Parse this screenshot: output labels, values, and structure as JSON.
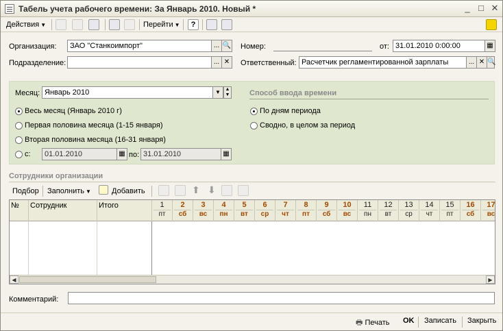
{
  "window": {
    "title": "Табель учета рабочего времени: За Январь 2010. Новый *",
    "minimize": "_",
    "maximize": "□",
    "close": "✕"
  },
  "toolbar": {
    "actions_label": "Действия",
    "goto_label": "Перейти",
    "help_label": "?"
  },
  "header": {
    "org_label": "Организация:",
    "org_value": "ЗАО \"Станкоимпорт\"",
    "dept_label": "Подразделение:",
    "dept_value": "",
    "number_label": "Номер:",
    "number_value": "",
    "date_label": "от:",
    "date_value": "31.01.2010  0:00:00",
    "resp_label": "Ответственный:",
    "resp_value": "Расчетчик регламентированной зарплаты",
    "ellipsis": "...",
    "search": "🔍",
    "clear": "✕"
  },
  "period": {
    "month_label": "Месяц:",
    "month_value": "Январь 2010",
    "options": [
      {
        "label": "Весь месяц (Январь 2010 г)",
        "selected": true
      },
      {
        "label": "Первая половина месяца (1-15 января)",
        "selected": false
      },
      {
        "label": "Вторая половина месяца (16-31 января)",
        "selected": false
      },
      {
        "label": "с:",
        "selected": false
      }
    ],
    "from_value": "01.01.2010",
    "to_label": "по:",
    "to_value": "31.01.2010"
  },
  "input_method": {
    "title": "Способ ввода времени",
    "options": [
      {
        "label": "По дням периода",
        "selected": true
      },
      {
        "label": "Сводно, в целом за период",
        "selected": false
      }
    ]
  },
  "employees": {
    "section_title": "Сотрудники организации",
    "toolbar": {
      "pick_label": "Подбор",
      "fill_label": "Заполнить",
      "add_label": "Добавить"
    },
    "columns": {
      "num": "№",
      "employee": "Сотрудник",
      "total": "Итого"
    },
    "days": [
      {
        "n": "1",
        "d": "пт",
        "weekend": false
      },
      {
        "n": "2",
        "d": "сб",
        "weekend": true
      },
      {
        "n": "3",
        "d": "вс",
        "weekend": true
      },
      {
        "n": "4",
        "d": "пн",
        "weekend": true
      },
      {
        "n": "5",
        "d": "вт",
        "weekend": true
      },
      {
        "n": "6",
        "d": "ср",
        "weekend": true
      },
      {
        "n": "7",
        "d": "чт",
        "weekend": true
      },
      {
        "n": "8",
        "d": "пт",
        "weekend": true
      },
      {
        "n": "9",
        "d": "сб",
        "weekend": true
      },
      {
        "n": "10",
        "d": "вс",
        "weekend": true
      },
      {
        "n": "11",
        "d": "пн",
        "weekend": false
      },
      {
        "n": "12",
        "d": "вт",
        "weekend": false
      },
      {
        "n": "13",
        "d": "ср",
        "weekend": false
      },
      {
        "n": "14",
        "d": "чт",
        "weekend": false
      },
      {
        "n": "15",
        "d": "пт",
        "weekend": false
      },
      {
        "n": "16",
        "d": "сб",
        "weekend": true
      },
      {
        "n": "17",
        "d": "вс",
        "weekend": true
      }
    ],
    "rows": []
  },
  "comment": {
    "label": "Комментарий:",
    "value": ""
  },
  "footer": {
    "print_label": "Печать",
    "ok_label": "OK",
    "save_label": "Записать",
    "close_label": "Закрыть"
  },
  "colors": {
    "panel_bg": "#dfe7cf",
    "weekend_day": "#a44a00"
  }
}
